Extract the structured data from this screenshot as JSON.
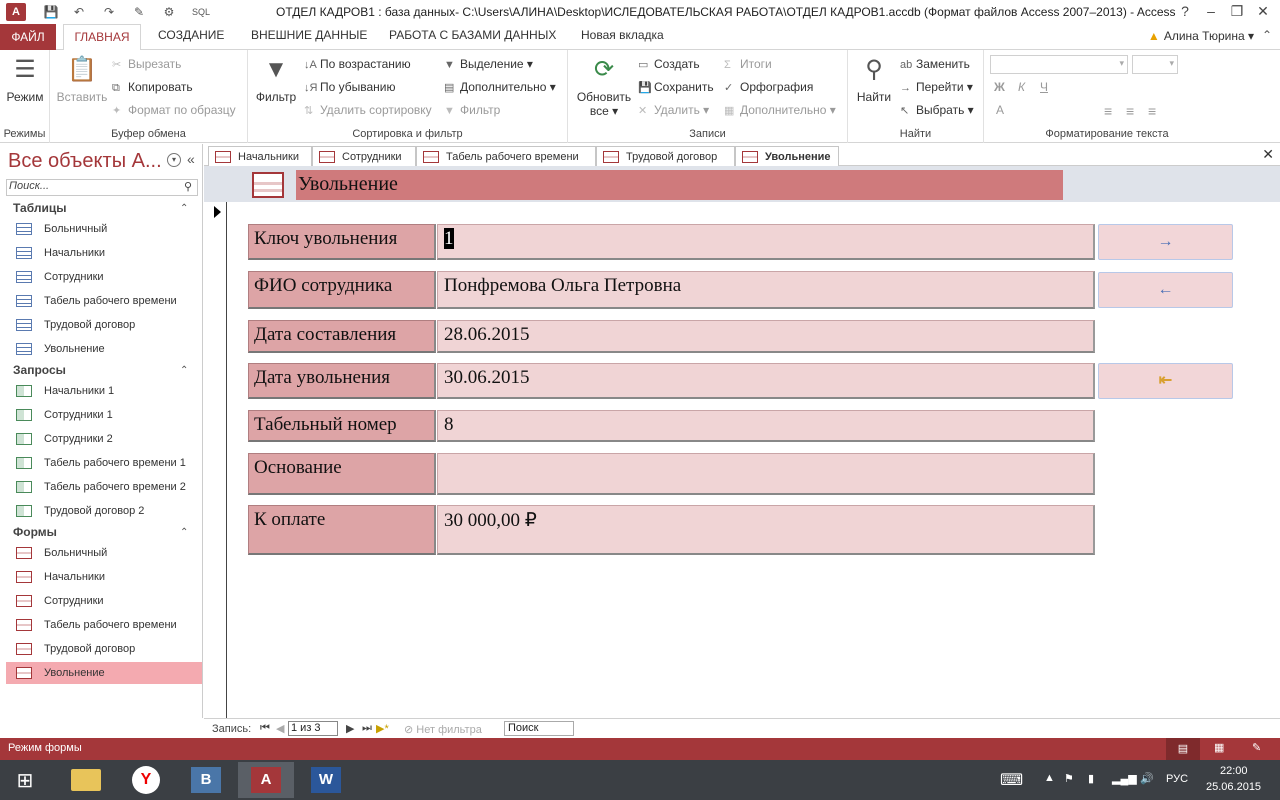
{
  "window": {
    "title": "ОТДЕЛ КАДРОВ1 : база данных- C:\\Users\\АЛИНА\\Desktop\\ИСЛЕДОВАТЕЛЬСКАЯ РАБОТА\\ОТДЕЛ КАДРОВ1.accdb (Формат файлов Access 2007–2013) - Access",
    "app_badge": "A",
    "qa_sql": "SQL",
    "help": "?",
    "minimize": "–",
    "restore": "❐",
    "close": "✕"
  },
  "ribbon_tabs": {
    "file": "ФАЙЛ",
    "home": "ГЛАВНАЯ",
    "create": "СОЗДАНИЕ",
    "external": "ВНЕШНИЕ ДАННЫЕ",
    "db_tools": "РАБОТА С БАЗАМИ ДАННЫХ",
    "new_tab": "Новая вкладка",
    "user": "Алина Тюрина"
  },
  "ribbon": {
    "views": {
      "label": "Режим",
      "group": "Режимы"
    },
    "clipboard": {
      "paste": "Вставить",
      "cut": "Вырезать",
      "copy": "Копировать",
      "format_painter": "Формат по образцу",
      "group": "Буфер обмена"
    },
    "sort_filter": {
      "filter": "Фильтр",
      "ascending": "По возрастанию",
      "descending": "По убыванию",
      "remove_sort": "Удалить сортировку",
      "selection": "Выделение",
      "advanced": "Дополнительно",
      "toggle_filter": "Фильтр",
      "group": "Сортировка и фильтр"
    },
    "records": {
      "refresh": "Обновить все",
      "new": "Создать",
      "save": "Сохранить",
      "delete": "Удалить",
      "totals": "Итоги",
      "spelling": "Орфография",
      "more": "Дополнительно",
      "group": "Записи"
    },
    "find": {
      "find": "Найти",
      "replace": "Заменить",
      "goto": "Перейти",
      "select": "Выбрать",
      "group": "Найти"
    },
    "text_format": {
      "bold": "Ж",
      "italic": "К",
      "underline": "Ч",
      "font_color": "A",
      "group": "Форматирование текста"
    }
  },
  "nav_pane": {
    "title": "Все объекты A...",
    "search_placeholder": "Поиск...",
    "sections": [
      {
        "title": "Таблицы",
        "items": [
          "Больничный",
          "Начальники",
          "Сотрудники",
          "Табель рабочего времени",
          "Трудовой договор",
          "Увольнение"
        ]
      },
      {
        "title": "Запросы",
        "items": [
          "Начальники 1",
          "Сотрудники 1",
          "Сотрудники 2",
          "Табель рабочего времени 1",
          "Табель рабочего времени 2",
          "Трудовой договор 2"
        ]
      },
      {
        "title": "Формы",
        "items": [
          "Больничный",
          "Начальники",
          "Сотрудники",
          "Табель рабочего времени",
          "Трудовой договор",
          "Увольнение"
        ]
      }
    ]
  },
  "doc_tabs": [
    "Начальники",
    "Сотрудники",
    "Табель рабочего времени",
    "Трудовой договор",
    "Увольнение"
  ],
  "form": {
    "title": "Увольнение",
    "fields": [
      {
        "label": "Ключ увольнения",
        "value": "1"
      },
      {
        "label": "ФИО сотрудника",
        "value": "Понфремова Ольга Петровна"
      },
      {
        "label": "Дата составления",
        "value": "28.06.2015"
      },
      {
        "label": "Дата увольнения",
        "value": "30.06.2015"
      },
      {
        "label": "Табельный номер",
        "value": "8"
      },
      {
        "label": "Основание",
        "value": ""
      },
      {
        "label": "К оплате",
        "value": "30 000,00 ₽"
      }
    ],
    "buttons": {
      "next": "→",
      "prev": "←",
      "exit": "⇤"
    }
  },
  "record_nav": {
    "label": "Запись:",
    "current": "1 из 3",
    "no_filter": "Нет фильтра",
    "search": "Поиск"
  },
  "status": {
    "mode": "Режим формы"
  },
  "taskbar": {
    "lang": "РУС",
    "time": "22:00",
    "date": "25.06.2015",
    "vk": "B",
    "access": "A",
    "word": "W"
  }
}
